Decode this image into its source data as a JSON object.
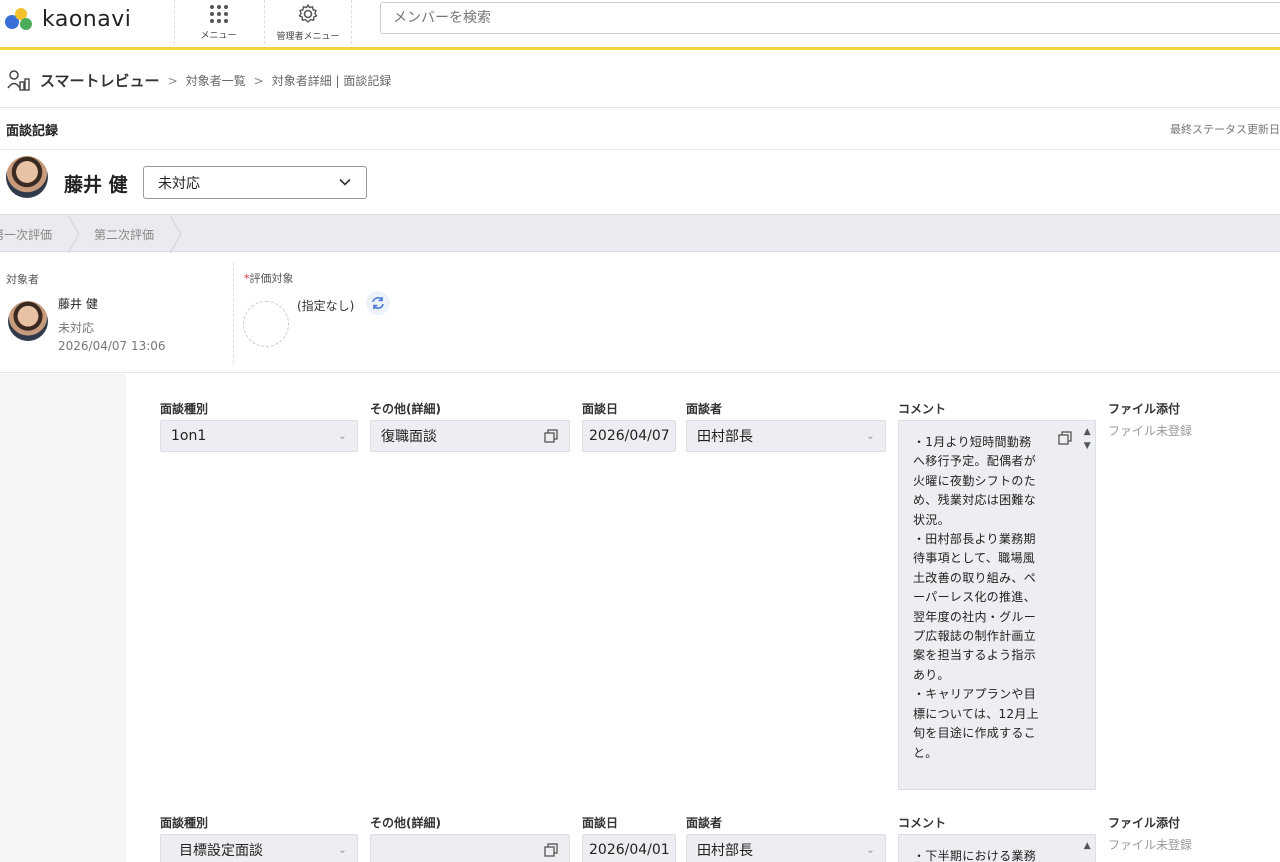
{
  "header": {
    "logo_text": "kaonavi",
    "menu_label": "メニュー",
    "admin_menu_label": "管理者メニュー",
    "search_placeholder": "メンバーを検索"
  },
  "breadcrumb": {
    "app": "スマートレビュー",
    "level1": "対象者一覧",
    "level2": "対象者詳細 | 面談記録",
    "separator": ">"
  },
  "section": {
    "title": "面談記録",
    "right_label": "最終ステータス更新日"
  },
  "person": {
    "name": "藤井 健",
    "status": "未対応"
  },
  "steps": [
    "第一次評価",
    "第二次評価"
  ],
  "info": {
    "target_label": "対象者",
    "target_name": "藤井 健",
    "target_status": "未対応",
    "target_date": "2026/04/07 13:06",
    "eval_label_required": "*",
    "eval_label": "評価対象",
    "eval_value": "(指定なし)"
  },
  "labels": {
    "type": "面談種別",
    "other": "その他(詳細)",
    "date": "面談日",
    "interviewer": "面談者",
    "comment": "コメント",
    "file": "ファイル添付",
    "file_empty": "ファイル未登録"
  },
  "records": [
    {
      "type": "1on1",
      "other": "復職面談",
      "date": "2026/04/07",
      "interviewer": "田村部長",
      "comment_lines": [
        "・1月より短時間勤務",
        "へ移行予定。配偶者が",
        "火曜に夜勤シフトのた",
        "め、残業対応は困難な",
        "状況。",
        "・田村部長より業務期",
        "待事項として、職場風",
        "土改善の取り組み、ペ",
        "ーパーレス化の推進、",
        "翌年度の社内・グルー",
        "プ広報誌の制作計画立",
        "案を担当するよう指示",
        "あり。",
        "・キャリアプランや目",
        "標については、12月上",
        "旬を目途に作成するこ",
        "と。"
      ]
    },
    {
      "type": "目標設定面談",
      "other": "",
      "date": "2026/04/01",
      "interviewer": "田村部長",
      "comment_lines": [
        "・下半期における業務"
      ]
    }
  ]
}
